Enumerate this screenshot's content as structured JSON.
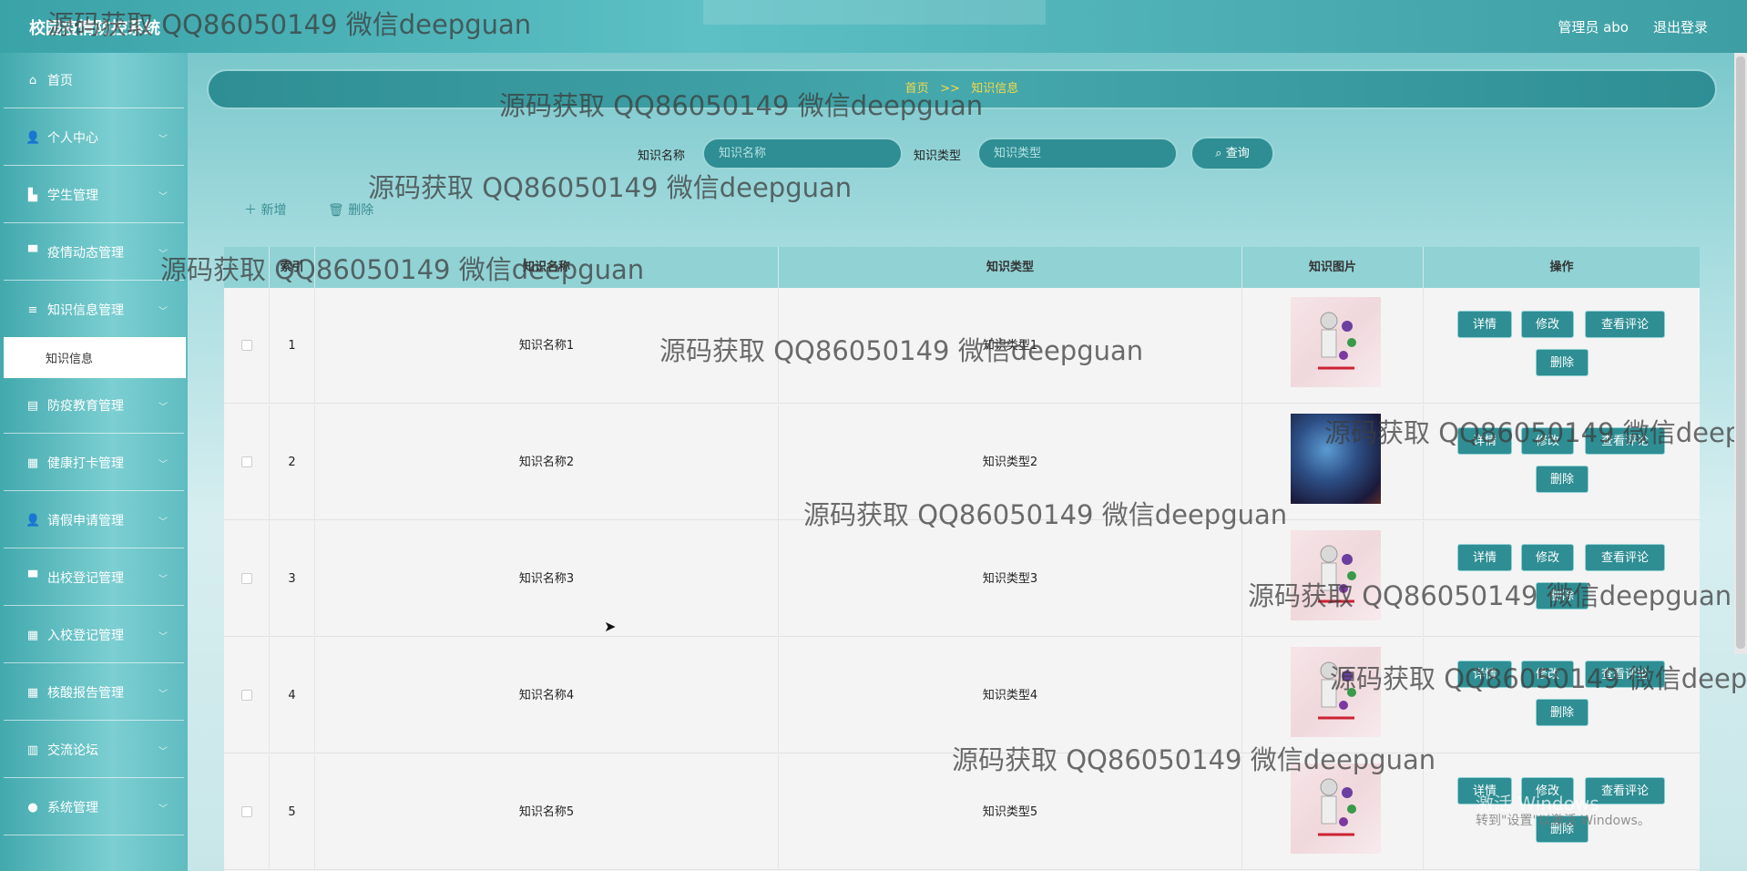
{
  "app": {
    "title": "校园疫情防控系统",
    "user": "管理员 abo",
    "logout": "退出登录"
  },
  "sidebar": {
    "items": [
      {
        "label": "首页",
        "icon": "home-icon",
        "glyph": "⌂",
        "chev": ""
      },
      {
        "label": "个人中心",
        "icon": "user-icon",
        "glyph": "👤",
        "chev": "﹀"
      },
      {
        "label": "学生管理",
        "icon": "school-icon",
        "glyph": "▙",
        "chev": "﹀"
      },
      {
        "label": "疫情动态管理",
        "icon": "monitor-icon",
        "glyph": "▀",
        "chev": "﹀"
      },
      {
        "label": "知识信息管理",
        "icon": "list-icon",
        "glyph": "≡",
        "chev": "﹀"
      },
      {
        "label": "防疫教育管理",
        "icon": "chart-icon",
        "glyph": "▤",
        "chev": "﹀"
      },
      {
        "label": "健康打卡管理",
        "icon": "grid-icon",
        "glyph": "▦",
        "chev": "﹀"
      },
      {
        "label": "请假申请管理",
        "icon": "user-icon",
        "glyph": "👤",
        "chev": "﹀"
      },
      {
        "label": "出校登记管理",
        "icon": "message-icon",
        "glyph": "▀",
        "chev": "﹀"
      },
      {
        "label": "入校登记管理",
        "icon": "grid-icon",
        "glyph": "▦",
        "chev": "﹀"
      },
      {
        "label": "核酸报告管理",
        "icon": "grid-icon",
        "glyph": "▦",
        "chev": "﹀"
      },
      {
        "label": "交流论坛",
        "icon": "bar-icon",
        "glyph": "▥",
        "chev": "﹀"
      },
      {
        "label": "系统管理",
        "icon": "pin-icon",
        "glyph": "●",
        "chev": "﹀"
      }
    ],
    "sub_active": "知识信息"
  },
  "breadcrumb": {
    "home": "首页",
    "sep": ">>",
    "current": "知识信息"
  },
  "search": {
    "name_label": "知识名称",
    "name_placeholder": "知识名称",
    "type_label": "知识类型",
    "type_placeholder": "知识类型",
    "button": "查询"
  },
  "actions": {
    "add": "新增",
    "delete": "删除"
  },
  "table": {
    "headers": {
      "index": "索引",
      "name": "知识名称",
      "type": "知识类型",
      "image": "知识图片",
      "ops": "操作"
    },
    "rows": [
      {
        "index": "1",
        "name": "知识名称1",
        "type": "知识类型1"
      },
      {
        "index": "2",
        "name": "知识名称2",
        "type": "知识类型2"
      },
      {
        "index": "3",
        "name": "知识名称3",
        "type": "知识类型3"
      },
      {
        "index": "4",
        "name": "知识名称4",
        "type": "知识类型4"
      },
      {
        "index": "5",
        "name": "知识名称5",
        "type": "知识类型5"
      }
    ],
    "btn": {
      "detail": "详情",
      "edit": "修改",
      "comment": "查看评论",
      "delete": "删除"
    }
  },
  "watermark": "源码获取 QQ86050149 微信deepguan",
  "windows_activate": {
    "line1": "激活 Windows",
    "line2": "转到\"设置\"以激活 Windows。"
  }
}
